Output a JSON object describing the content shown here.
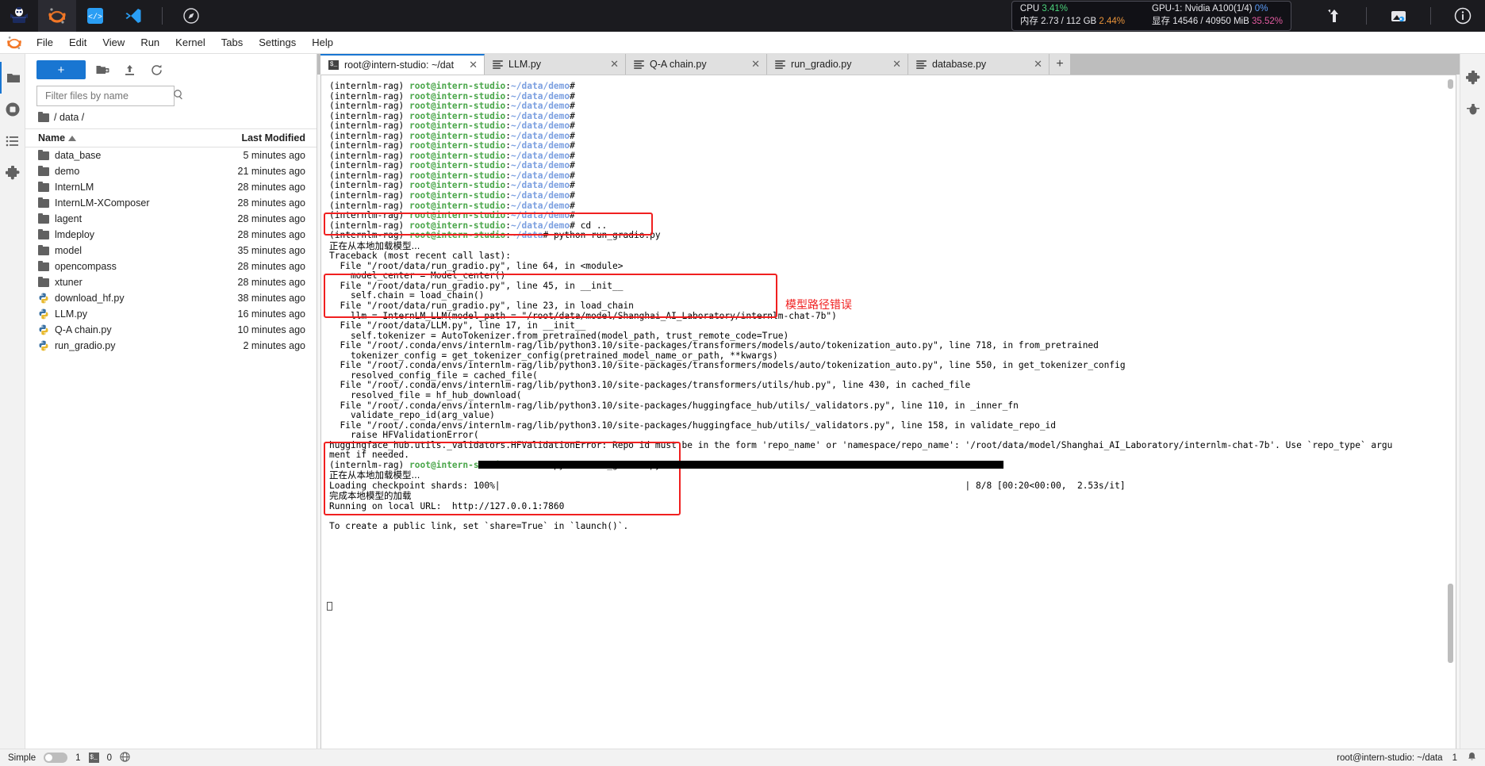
{
  "os_bar": {
    "apps": [
      {
        "name": "internlm-logo",
        "active": false
      },
      {
        "name": "jupyter-logo",
        "active": true
      },
      {
        "name": "code-brackets",
        "active": false
      },
      {
        "name": "vscode-logo",
        "active": false
      },
      {
        "name": "compass-logo",
        "active": false
      }
    ],
    "sysmon": {
      "cpu_label": "CPU",
      "cpu_value": "3.41%",
      "mem_label": "内存",
      "mem_value": "2.73 / 112 GB",
      "mem_pct": "2.44%",
      "gpu_label": "GPU-1: Nvidia A100(1/4)",
      "gpu_value": "0%",
      "vram_label": "显存",
      "vram_value": "14546 / 40950 MiB",
      "vram_pct": "35.52%"
    },
    "right_icons": [
      "network-upload-icon",
      "screenshot-icon",
      "info-icon"
    ]
  },
  "menubar": {
    "items": [
      "File",
      "Edit",
      "View",
      "Run",
      "Kernel",
      "Tabs",
      "Settings",
      "Help"
    ]
  },
  "left_rail": {
    "items": [
      "file-browser-icon",
      "running-terminals-icon",
      "table-of-contents-icon",
      "extensions-icon"
    ]
  },
  "right_rail": {
    "items": [
      "property-inspector-icon",
      "debugger-icon"
    ]
  },
  "filebrowser": {
    "new_button_label": "+",
    "toolbar_icons": [
      "new-folder-icon",
      "upload-icon",
      "refresh-icon"
    ],
    "filter_placeholder": "Filter files by name",
    "filter_value": "",
    "breadcrumb": "/ data /",
    "columns": {
      "name": "Name",
      "modified": "Last Modified"
    },
    "rows": [
      {
        "icon": "folder-icon",
        "name": "data_base",
        "modified": "5 minutes ago"
      },
      {
        "icon": "folder-icon",
        "name": "demo",
        "modified": "21 minutes ago"
      },
      {
        "icon": "folder-icon",
        "name": "InternLM",
        "modified": "28 minutes ago"
      },
      {
        "icon": "folder-icon",
        "name": "InternLM-XComposer",
        "modified": "28 minutes ago"
      },
      {
        "icon": "folder-icon",
        "name": "lagent",
        "modified": "28 minutes ago"
      },
      {
        "icon": "folder-icon",
        "name": "lmdeploy",
        "modified": "28 minutes ago"
      },
      {
        "icon": "folder-icon",
        "name": "model",
        "modified": "35 minutes ago"
      },
      {
        "icon": "folder-icon",
        "name": "opencompass",
        "modified": "28 minutes ago"
      },
      {
        "icon": "folder-icon",
        "name": "xtuner",
        "modified": "28 minutes ago"
      },
      {
        "icon": "python-icon",
        "name": "download_hf.py",
        "modified": "38 minutes ago"
      },
      {
        "icon": "python-icon",
        "name": "LLM.py",
        "modified": "16 minutes ago"
      },
      {
        "icon": "python-icon",
        "name": "Q-A chain.py",
        "modified": "10 minutes ago"
      },
      {
        "icon": "python-icon",
        "name": "run_gradio.py",
        "modified": "2 minutes ago"
      }
    ]
  },
  "tabs": [
    {
      "icon": "terminal-icon",
      "label": "root@intern-studio: ~/dat",
      "active": true
    },
    {
      "icon": "python-file-icon",
      "label": "LLM.py",
      "active": false
    },
    {
      "icon": "python-file-icon",
      "label": "Q-A chain.py",
      "active": false
    },
    {
      "icon": "python-file-icon",
      "label": "run_gradio.py",
      "active": false
    },
    {
      "icon": "python-file-icon",
      "label": "database.py",
      "active": false
    }
  ],
  "tab_add_label": "+",
  "terminal": {
    "prompt_prefix": "(internlm-rag) ",
    "prompt_user": "root@intern-studio",
    "prompt_colon": ":",
    "prompt_path_demo": "~/data/demo",
    "prompt_path_data": "~/data",
    "prompt_hash": "#",
    "repeated_prompt_count": 14,
    "line_cd": " cd ..",
    "cmd_run": " python run_gradio.py",
    "loading_cn": "正在从本地加载模型...",
    "traceback_lines": [
      "Traceback (most recent call last):",
      "  File \"/root/data/run_gradio.py\", line 64, in <module>",
      "    model_center = Model_center()",
      "  File \"/root/data/run_gradio.py\", line 45, in __init__",
      "    self.chain = load_chain()",
      "  File \"/root/data/run_gradio.py\", line 23, in load_chain",
      "    llm = InternLM_LLM(model_path = \"/root/data/model/Shanghai_AI_Laboratory/internlm-chat-7b\")",
      "  File \"/root/data/LLM.py\", line 17, in __init__",
      "    self.tokenizer = AutoTokenizer.from_pretrained(model_path, trust_remote_code=True)",
      "  File \"/root/.conda/envs/internlm-rag/lib/python3.10/site-packages/transformers/models/auto/tokenization_auto.py\", line 718, in from_pretrained",
      "    tokenizer_config = get_tokenizer_config(pretrained_model_name_or_path, **kwargs)",
      "  File \"/root/.conda/envs/internlm-rag/lib/python3.10/site-packages/transformers/models/auto/tokenization_auto.py\", line 550, in get_tokenizer_config",
      "    resolved_config_file = cached_file(",
      "  File \"/root/.conda/envs/internlm-rag/lib/python3.10/site-packages/transformers/utils/hub.py\", line 430, in cached_file",
      "    resolved_file = hf_hub_download(",
      "  File \"/root/.conda/envs/internlm-rag/lib/python3.10/site-packages/huggingface_hub/utils/_validators.py\", line 110, in _inner_fn",
      "    validate_repo_id(arg_value)",
      "  File \"/root/.conda/envs/internlm-rag/lib/python3.10/site-packages/huggingface_hub/utils/_validators.py\", line 158, in validate_repo_id",
      "    raise HFValidationError("
    ],
    "error_line_1": "huggingface_hub.utils._validators.HFValidationError: Repo id must be in the form 'repo_name' or 'namespace/repo_name': '/root/data/model/Shanghai_AI_Laboratory/internlm-chat-7b'. Use `repo_type` argu",
    "error_line_2": "ment if needed.",
    "success_lines": [
      "Loading checkpoint shards: 100%|",
      "完成本地模型的加载",
      "Running on local URL:  http://127.0.0.1:7860",
      "",
      "To create a public link, set `share=True` in `launch()`."
    ],
    "progress_suffix": "| 8/8 [00:20<00:00,  2.53s/it]",
    "annotation_model_path_error": "模型路径错误",
    "annotation_color": "#f02020"
  },
  "statusbar": {
    "simple_label": "Simple",
    "toggle_on": false,
    "terminal_count": "1",
    "kernel_icon": "kernel-icon",
    "kernel_count": "0",
    "language_icon": "language-icon",
    "right_path": "root@intern-studio: ~/data",
    "right_count": "1",
    "notification_icon": "bell-icon"
  }
}
